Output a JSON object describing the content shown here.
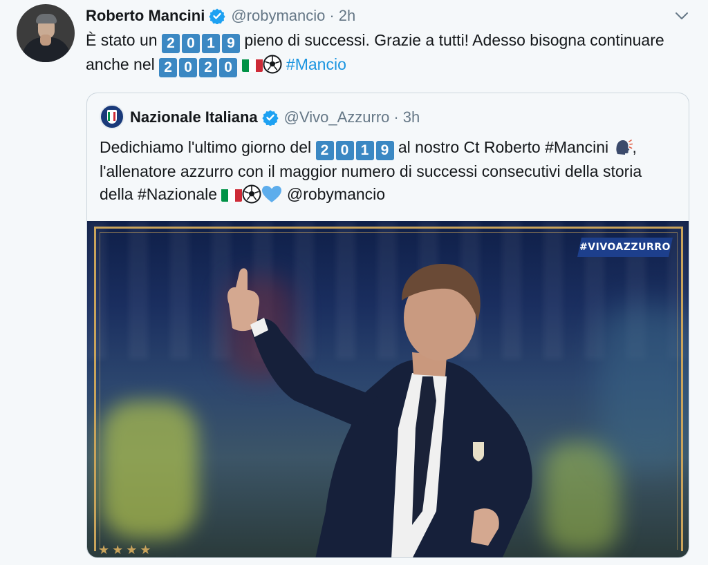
{
  "tweet": {
    "author_name": "Roberto Mancini",
    "handle": "@robymancio",
    "separator": "·",
    "time": "2h",
    "text_part1": "È stato un ",
    "year1": [
      "2",
      "0",
      "1",
      "9"
    ],
    "text_part2": " pieno di successi. Grazie a tutti! Adesso bisogna continuare anche nel ",
    "year2": [
      "2",
      "0",
      "2",
      "0"
    ],
    "hashtag": "#Mancio"
  },
  "quoted": {
    "author_name": "Nazionale Italiana",
    "handle": "@Vivo_Azzurro",
    "separator": "·",
    "time": "3h",
    "text_part1": "Dedichiamo l'ultimo giorno del ",
    "year": [
      "2",
      "0",
      "1",
      "9"
    ],
    "text_part2": " al nostro Ct Roberto #Mancini ",
    "text_part3": ", l'allenatore azzurro con il maggior numero di successi consecutivi della storia della #Nazionale ",
    "mention": "@robymancio",
    "image_tag": "#VIVOAZZURRO",
    "stars": "★★★★"
  },
  "colors": {
    "digit_bg": "#3b88c3",
    "link": "#1b95e0",
    "verified": "#1da1f2",
    "flag_green": "#009246",
    "flag_white": "#ffffff",
    "flag_red": "#ce2b37",
    "heart": "#5dadec",
    "gold": "#c9a35b"
  },
  "icons": {
    "verified": "verified-badge-icon",
    "menu": "chevron-down-icon",
    "flag": "italy-flag-icon",
    "ball": "soccer-ball-icon",
    "speaking": "speaking-head-icon",
    "heart": "blue-heart-icon"
  }
}
